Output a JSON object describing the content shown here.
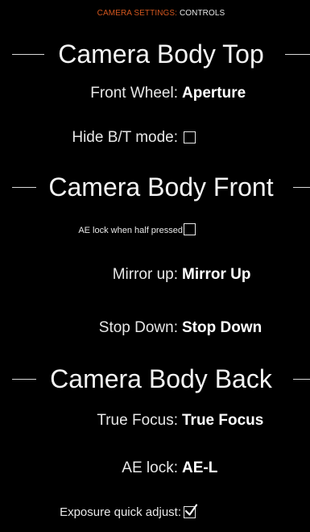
{
  "header": {
    "accent": "CAMERA SETTINGS:",
    "rest": " CONTROLS"
  },
  "sections": {
    "top": {
      "title": "Camera Body Top"
    },
    "front": {
      "title": "Camera Body Front"
    },
    "back": {
      "title": "Camera Body Back"
    }
  },
  "controls": {
    "front_wheel": {
      "label": "Front Wheel:",
      "value": "Aperture"
    },
    "hide_bt_mode": {
      "label": "Hide B/T mode:",
      "checked": false
    },
    "ae_lock_half": {
      "label": "AE lock when half pressed:",
      "checked": false
    },
    "mirror_up": {
      "label": "Mirror up:",
      "value": "Mirror Up"
    },
    "stop_down": {
      "label": "Stop Down:",
      "value": "Stop Down"
    },
    "true_focus": {
      "label": "True Focus:",
      "value": "True Focus"
    },
    "ae_lock": {
      "label": "AE lock:",
      "value": "AE-L"
    },
    "exposure_quick_adjust": {
      "label": "Exposure quick adjust:",
      "checked": true
    }
  },
  "colors": {
    "background": "#000000",
    "accent": "#d2561e",
    "text": "#f2f2f2"
  }
}
